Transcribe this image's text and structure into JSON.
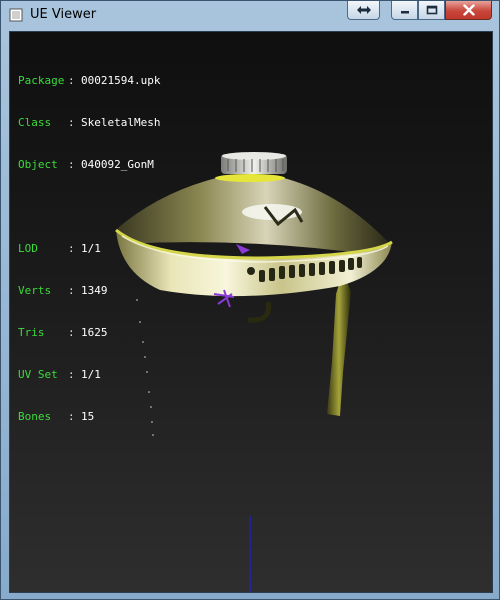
{
  "window": {
    "title": "UE Viewer",
    "controls": {
      "swap_icon": "swap-arrows-icon",
      "minimize_icon": "minimize-icon",
      "maximize_icon": "maximize-icon",
      "close_icon": "close-icon"
    }
  },
  "info": {
    "package": {
      "label": "Package",
      "value": "00021594.upk"
    },
    "class": {
      "label": "Class",
      "value": "SkeletalMesh"
    },
    "object": {
      "label": "Object",
      "value": "040092_GonM"
    },
    "lod": {
      "label": "LOD",
      "value": "1/1"
    },
    "verts": {
      "label": "Verts",
      "value": "1349"
    },
    "tris": {
      "label": "Tris",
      "value": "1625"
    },
    "uvset": {
      "label": "UV Set",
      "value": "1/1"
    },
    "bones": {
      "label": "Bones",
      "value": "15"
    },
    "separator": ":"
  },
  "colors": {
    "label": "#3cdc3c",
    "value": "#ffffff",
    "background_top": "#0f0f0f",
    "background_bottom": "#2e2e2e",
    "axis": "#1a1aff"
  }
}
